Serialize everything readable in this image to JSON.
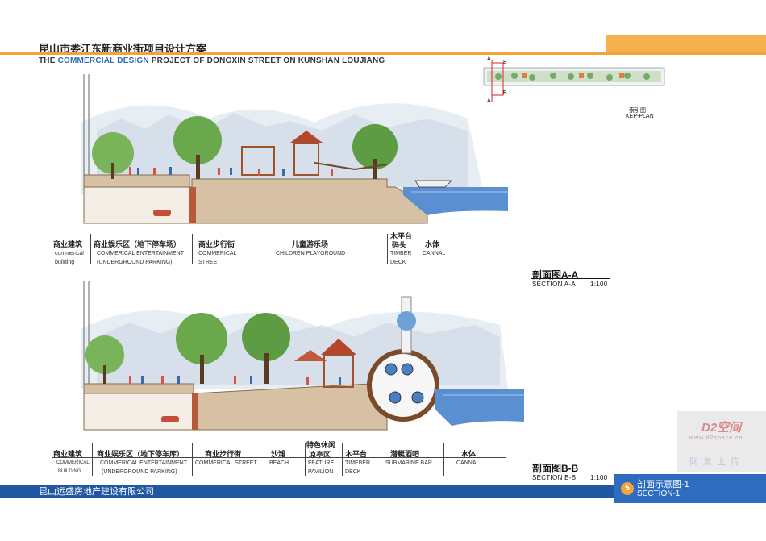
{
  "header": {
    "title_cn": "昆山市娄江东新商业街项目设计方案",
    "title_en_prefix": "THE ",
    "title_en_highlight": "COMMERCIAL DESIGN",
    "title_en_suffix": " PROJECT OF DONGXIN STREET ON KUNSHAN LOUJIANG",
    "accent_color": "#f2a33a",
    "highlight_color": "#2e6db5"
  },
  "keyplan": {
    "label_cn": "索引图",
    "label_en": "KEP-PLAN",
    "marker_a": "A",
    "marker_b": "B"
  },
  "section_a": {
    "title_cn": "剖面图A-A",
    "title_en": "SECTION A-A",
    "scale": "1:100",
    "zones": [
      {
        "cn": "商业建筑",
        "en1": "commerical",
        "en2": "building"
      },
      {
        "cn": "商业娱乐区（地下停车场）",
        "en1": "COMMERICAL ENTERTAINMENT",
        "en2": "(UNDERGROUND PARKING)"
      },
      {
        "cn": "商业步行街",
        "en1": "COMMERICAL",
        "en2": "STREET"
      },
      {
        "cn": "儿童游乐场",
        "en1": "CHILDREN PLAYGROUND",
        "en2": ""
      },
      {
        "cn": "木平台",
        "cn2": "码头",
        "en1": "TIMBER",
        "en2": "DECK"
      },
      {
        "cn": "水体",
        "en1": "CANNAL",
        "en2": ""
      }
    ]
  },
  "section_b": {
    "title_cn": "剖面图B-B",
    "title_en": "SECTION B-B",
    "scale": "1:100",
    "zones": [
      {
        "cn": "商业建筑",
        "en1": "COMMERICAL",
        "en2": "BUILDING"
      },
      {
        "cn": "商业娱乐区（地下停车库）",
        "en1": "COMMERICAL ENTERTAINMENT",
        "en2": "(UNDERGROUND PARKING)"
      },
      {
        "cn": "商业步行街",
        "en1": "COMMERICAL STREET",
        "en2": ""
      },
      {
        "cn": "沙滩",
        "en1": "BEACH",
        "en2": ""
      },
      {
        "cn": "特色休闲",
        "cn2": "凉亭区",
        "en1": "FEATURE",
        "en2": "PAVILION"
      },
      {
        "cn": "木平台",
        "en1": "TIMEBER",
        "en2": "DECK"
      },
      {
        "cn": "潜艇酒吧",
        "en1": "SUBMARINE BAR",
        "en2": ""
      },
      {
        "cn": "水体",
        "en1": "CANNAL",
        "en2": ""
      }
    ]
  },
  "footer": {
    "company": "昆山运盛房地产建设有限公司",
    "page_number": "5",
    "section_cn": "剖面示意图-1",
    "section_en": "SECTION-1",
    "bar_color": "#1f57a3"
  },
  "watermark": {
    "logo": "D2空间",
    "url": "www.d2space.cn",
    "text": "网友上传"
  }
}
